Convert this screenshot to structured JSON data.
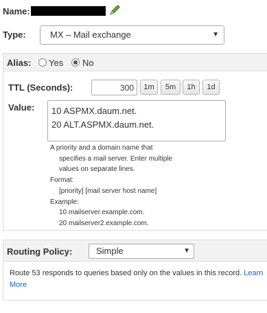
{
  "name_row": {
    "label": "Name:"
  },
  "type_row": {
    "label": "Type:",
    "selected": "MX – Mail exchange"
  },
  "alias": {
    "label": "Alias:",
    "options": [
      {
        "label": "Yes",
        "selected": false
      },
      {
        "label": "No",
        "selected": true
      }
    ]
  },
  "ttl": {
    "label": "TTL (Seconds):",
    "value": "300",
    "buttons": [
      "1m",
      "5m",
      "1h",
      "1d"
    ]
  },
  "value_field": {
    "label": "Value:",
    "lines": [
      "10 ASPMX.daum.net.",
      "20 ALT.ASPMX.daum.net."
    ],
    "help": {
      "intro_1": "A priority and a domain name that",
      "intro_2": "specifies a mail server. Enter multiple",
      "intro_3": "values on separate lines.",
      "format_label": "Format:",
      "format_value": "[priority] [mail server host name]",
      "example_label": "Example:",
      "example_1": "10 mailserver.example.com.",
      "example_2": "20 mailserver2.example.com."
    }
  },
  "routing": {
    "label": "Routing Policy:",
    "selected": "Simple",
    "description": "Route 53 responds to queries based only on the values in this record.",
    "link_text_1": "Learn",
    "link_text_2": "More"
  },
  "colors": {
    "link": "#1166bb",
    "band": "#f2f2f2",
    "pencil": "#5ea832"
  },
  "icons": {
    "edit": "pencil-icon",
    "dropdown": "chevron-down-icon"
  }
}
